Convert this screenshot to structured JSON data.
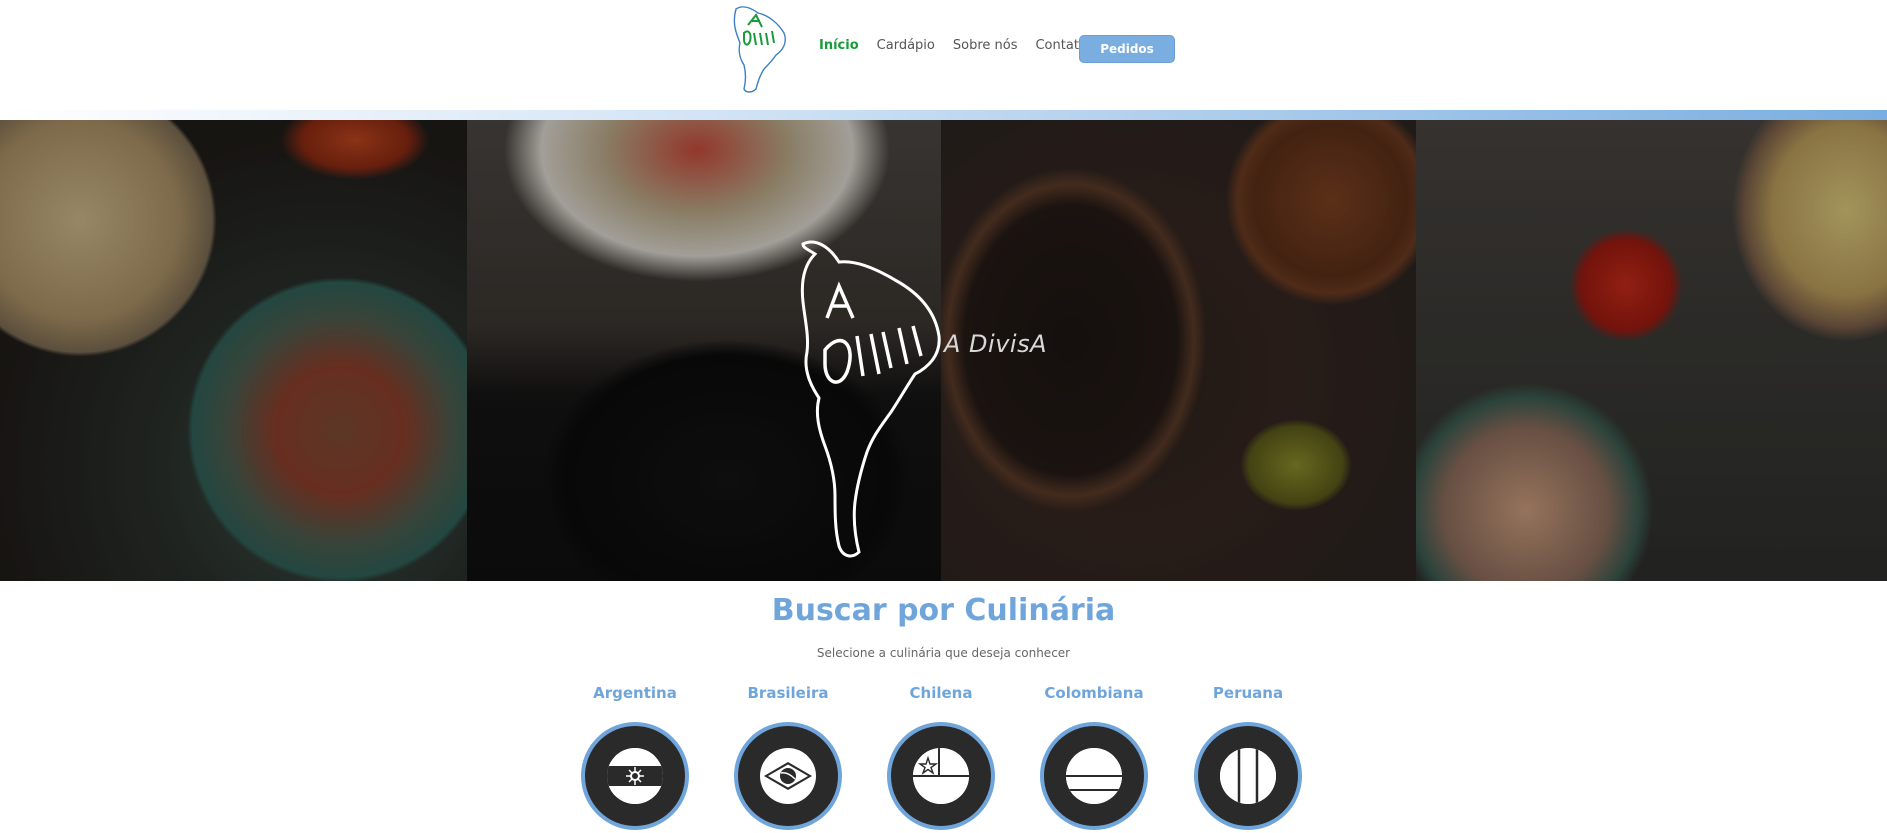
{
  "header": {
    "logo_text": "A DivisA",
    "nav": [
      {
        "label": "Início",
        "active": true
      },
      {
        "label": "Cardápio",
        "active": false
      },
      {
        "label": "Sobre nós",
        "active": false
      },
      {
        "label": "Contato",
        "active": false
      }
    ],
    "pedidos_label": "Pedidos"
  },
  "hero": {
    "brand": "A DivisA"
  },
  "cuisine_section": {
    "title": "Buscar por Culinária",
    "subtitle": "Selecione a culinária que deseja conhecer",
    "items": [
      {
        "label": "Argentina",
        "icon": "argentina-flag-icon"
      },
      {
        "label": "Brasileira",
        "icon": "brazil-flag-icon"
      },
      {
        "label": "Chilena",
        "icon": "chile-flag-icon"
      },
      {
        "label": "Colombiana",
        "icon": "colombia-flag-icon"
      },
      {
        "label": "Peruana",
        "icon": "peru-flag-icon"
      }
    ]
  },
  "colors": {
    "accent_blue": "#6fa5da",
    "active_green": "#1a9a3a",
    "button_blue": "#7aaee0"
  }
}
